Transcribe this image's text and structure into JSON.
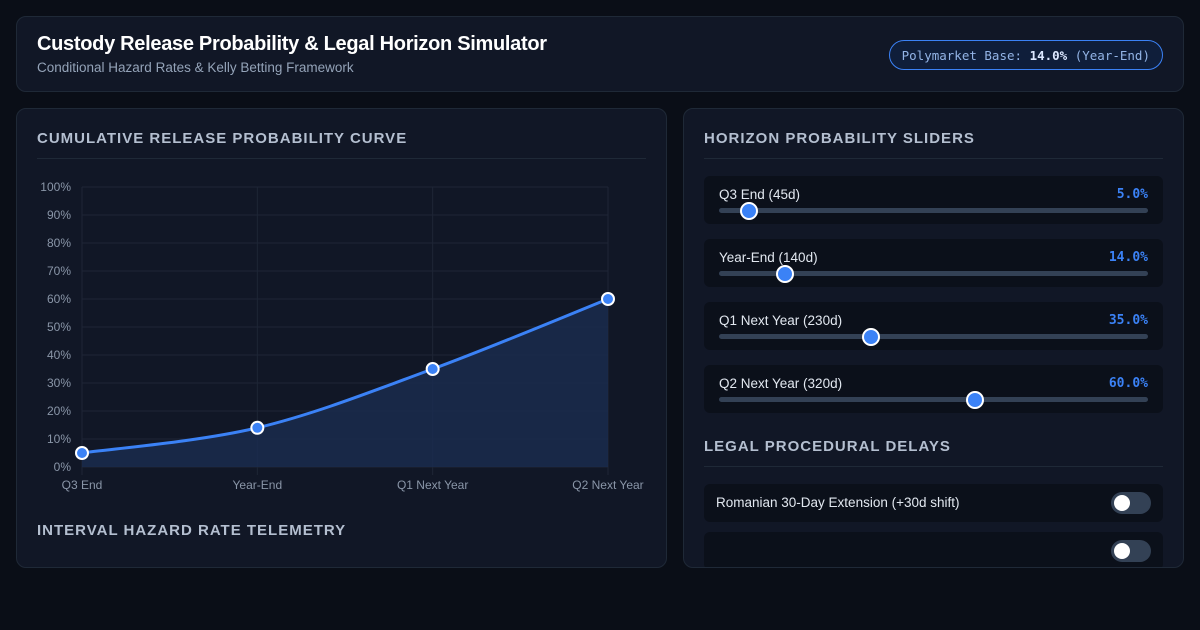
{
  "header": {
    "title": "Custody Release Probability & Legal Horizon Simulator",
    "subtitle": "Conditional Hazard Rates & Kelly Betting Framework",
    "badge_prefix": "Polymarket Base: ",
    "badge_value": "14.0%",
    "badge_suffix": " (Year-End)"
  },
  "left_panel": {
    "chart_title": "Cumulative Release Probability Curve",
    "telemetry_title": "Interval Hazard Rate Telemetry"
  },
  "chart_data": {
    "type": "line",
    "categories": [
      "Q3 End",
      "Year-End",
      "Q1 Next Year",
      "Q2 Next Year"
    ],
    "values": [
      5.0,
      14.0,
      35.0,
      60.0
    ],
    "ylim": [
      0,
      100
    ],
    "yticks": [
      "0%",
      "10%",
      "20%",
      "30%",
      "40%",
      "50%",
      "60%",
      "70%",
      "80%",
      "90%",
      "100%"
    ],
    "grid": true,
    "fill": true,
    "title": "",
    "xlabel": "",
    "ylabel": "",
    "line_color": "#3b82f6",
    "fill_color": "#1a2b4d"
  },
  "right_panel": {
    "sliders_title": "Horizon Probability Sliders",
    "sliders": [
      {
        "label": "Q3 End (45d)",
        "value_text": "5.0%",
        "level": 0.07
      },
      {
        "label": "Year-End (140d)",
        "value_text": "14.0%",
        "level": 0.155
      },
      {
        "label": "Q1 Next Year (230d)",
        "value_text": "35.0%",
        "level": 0.355
      },
      {
        "label": "Q2 Next Year (320d)",
        "value_text": "60.0%",
        "level": 0.597
      }
    ],
    "legal_title": "Legal Procedural Delays",
    "toggles": [
      {
        "label": "Romanian 30-Day Extension (+30d shift)",
        "on": false
      },
      {
        "label": "",
        "on": false
      }
    ]
  },
  "colors": {
    "accent": "#3b82f6",
    "background": "#0a0e17",
    "panel": "#111726"
  }
}
